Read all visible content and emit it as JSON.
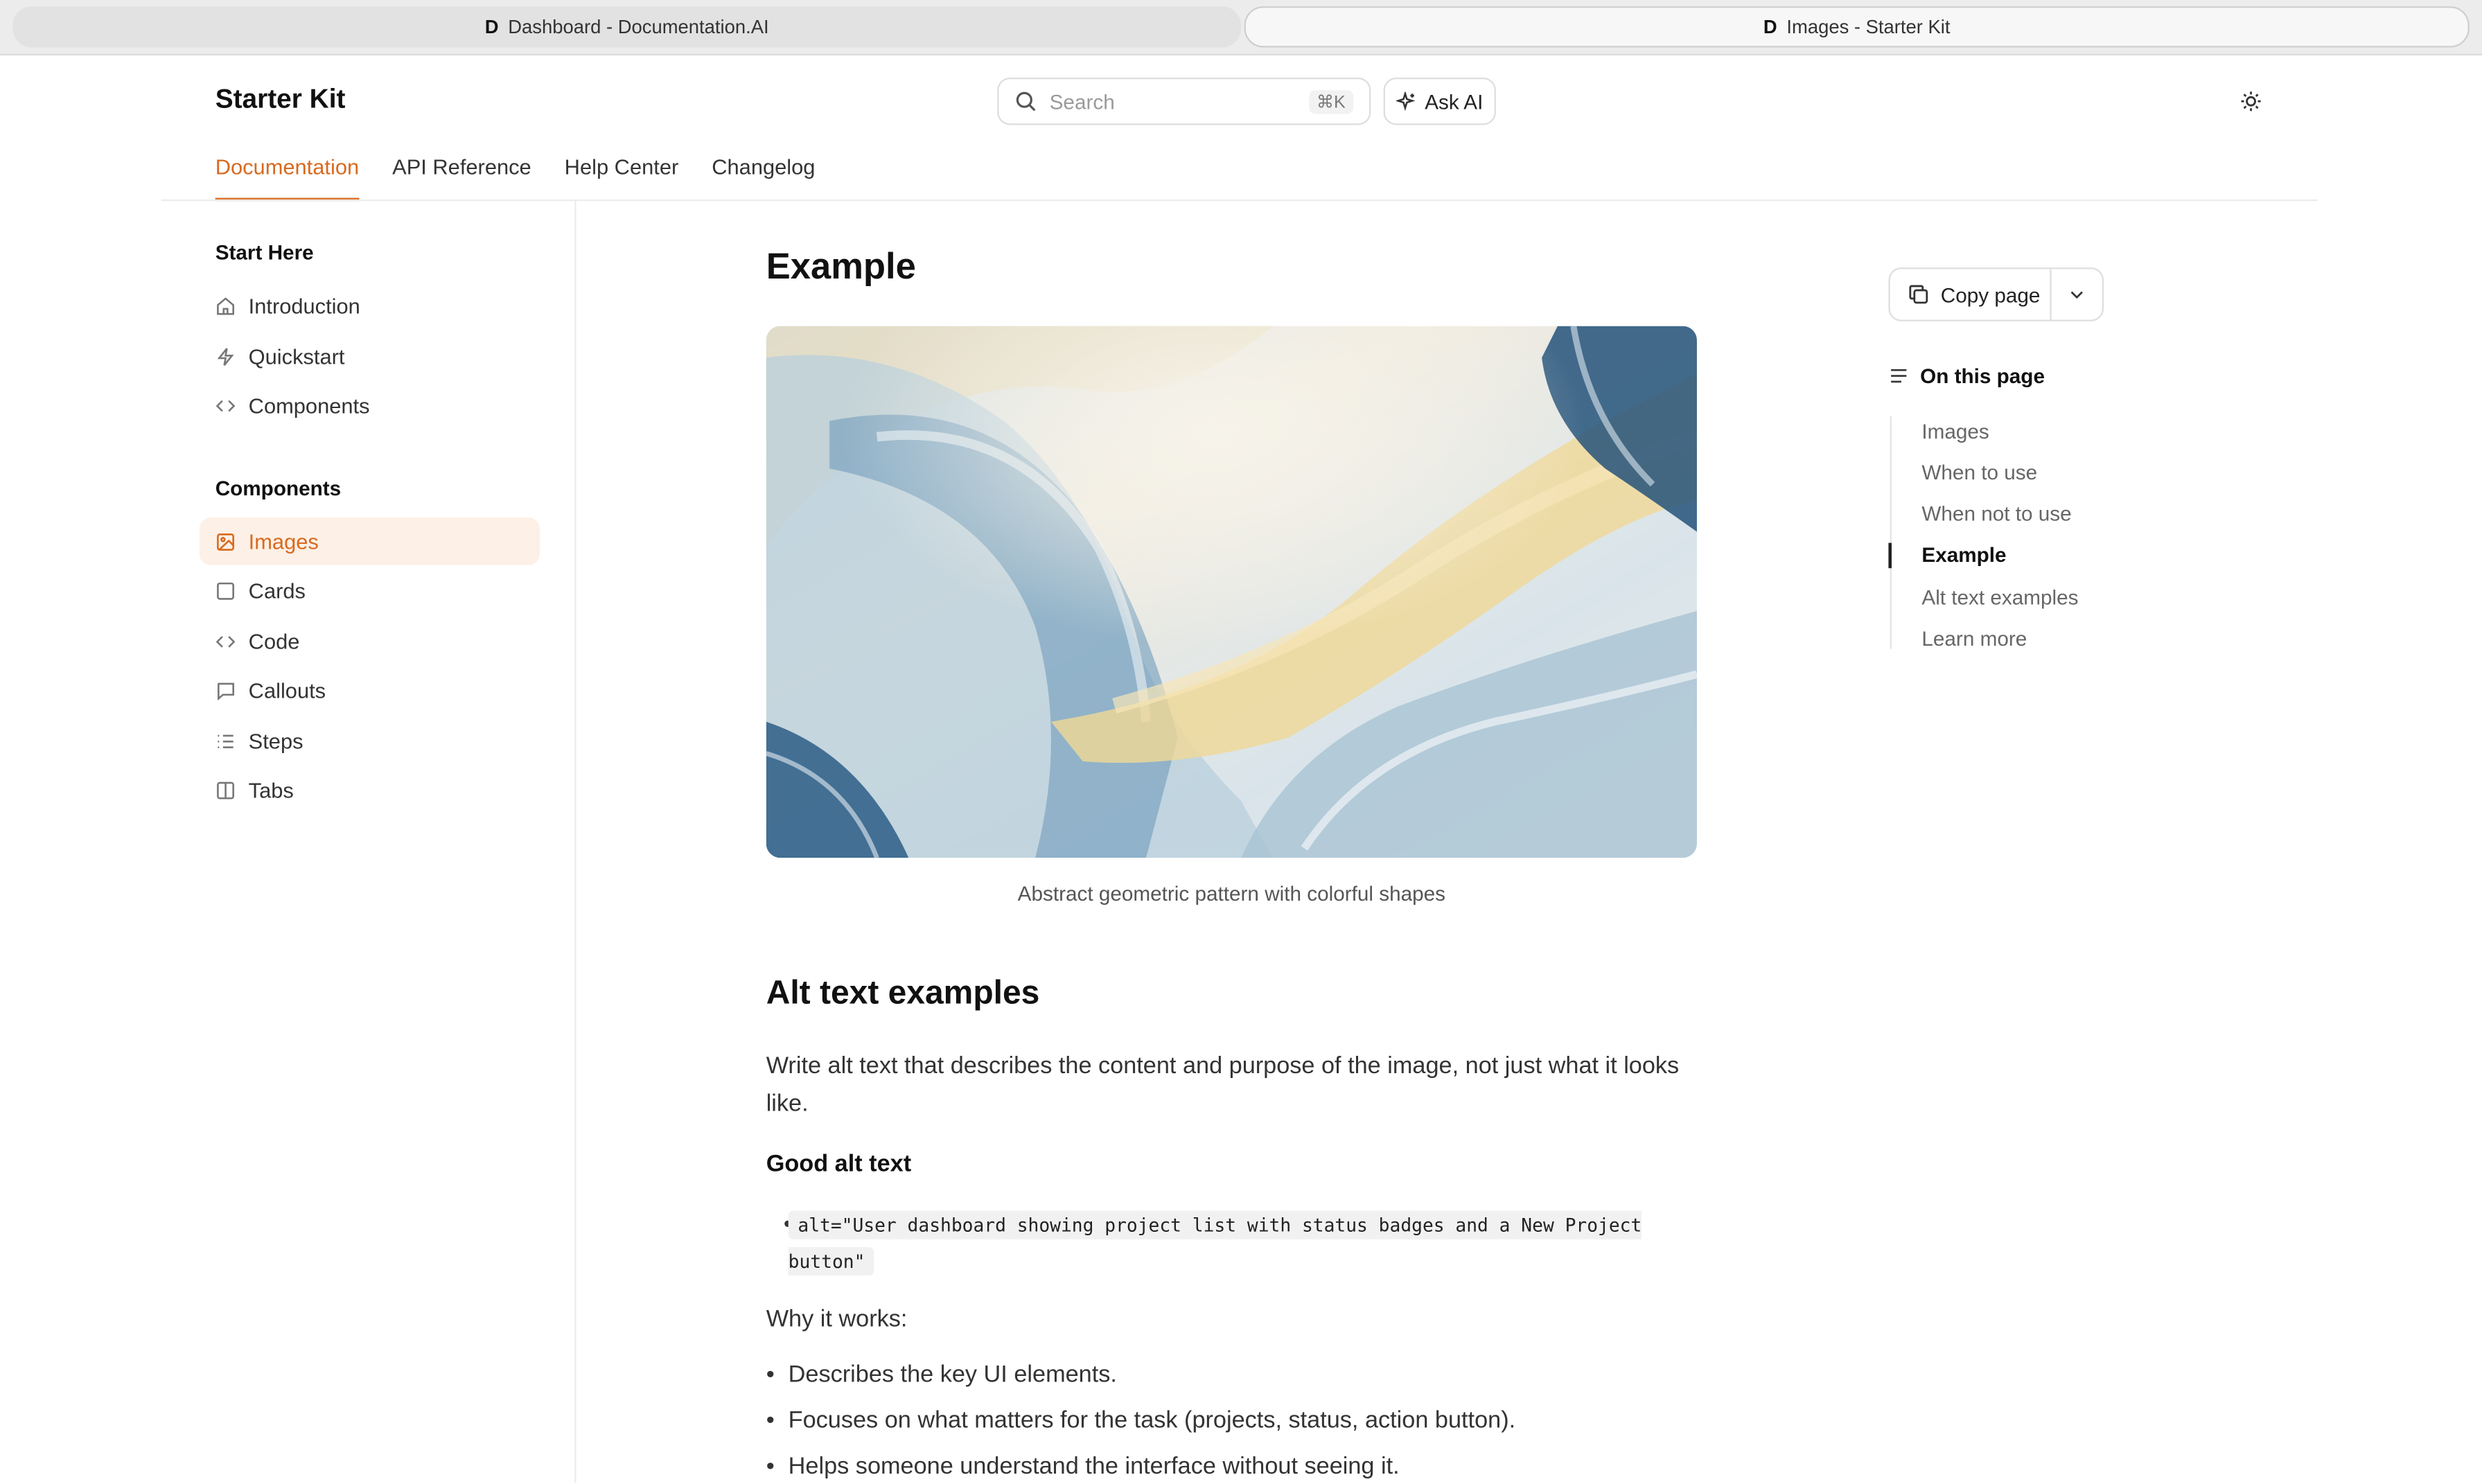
{
  "browser": {
    "tabs": [
      {
        "favicon": "D",
        "label": "Dashboard - Documentation.AI"
      },
      {
        "favicon": "D",
        "label": "Images - Starter Kit"
      }
    ]
  },
  "header": {
    "site_title": "Starter Kit",
    "search_placeholder": "Search",
    "search_shortcut": "⌘K",
    "ask_ai_label": "Ask AI",
    "nav_tabs": [
      "Documentation",
      "API Reference",
      "Help Center",
      "Changelog"
    ]
  },
  "sidebar": {
    "groups": [
      {
        "title": "Start Here",
        "items": [
          {
            "label": "Introduction",
            "icon": "home-icon"
          },
          {
            "label": "Quickstart",
            "icon": "bolt-icon"
          },
          {
            "label": "Components",
            "icon": "code-icon"
          }
        ]
      },
      {
        "title": "Components",
        "items": [
          {
            "label": "Images",
            "icon": "image-icon",
            "active": true
          },
          {
            "label": "Cards",
            "icon": "square-icon"
          },
          {
            "label": "Code",
            "icon": "code-icon"
          },
          {
            "label": "Callouts",
            "icon": "message-icon"
          },
          {
            "label": "Steps",
            "icon": "list-icon"
          },
          {
            "label": "Tabs",
            "icon": "columns-icon"
          }
        ]
      }
    ]
  },
  "main": {
    "heading": "Example",
    "image_caption": "Abstract geometric pattern with colorful shapes",
    "alt_heading": "Alt text examples",
    "alt_intro": "Write alt text that describes the content and purpose of the image, not just what it looks like.",
    "good_heading": "Good alt text",
    "good_example_code": "alt=\"User dashboard showing project list with status badges and a New Project button\"",
    "why_label": "Why it works:",
    "why_points": [
      "Describes the key UI elements.",
      "Focuses on what matters for the task (projects, status, action button).",
      "Helps someone understand the interface without seeing it."
    ]
  },
  "right_rail": {
    "copy_page_label": "Copy page",
    "toc_title": "On this page",
    "toc_items": [
      "Images",
      "When to use",
      "When not to use",
      "Example",
      "Alt text examples",
      "Learn more"
    ],
    "toc_active": "Example"
  },
  "colors": {
    "accent": "#d86a1f",
    "active_bg": "#fdf0e6"
  }
}
